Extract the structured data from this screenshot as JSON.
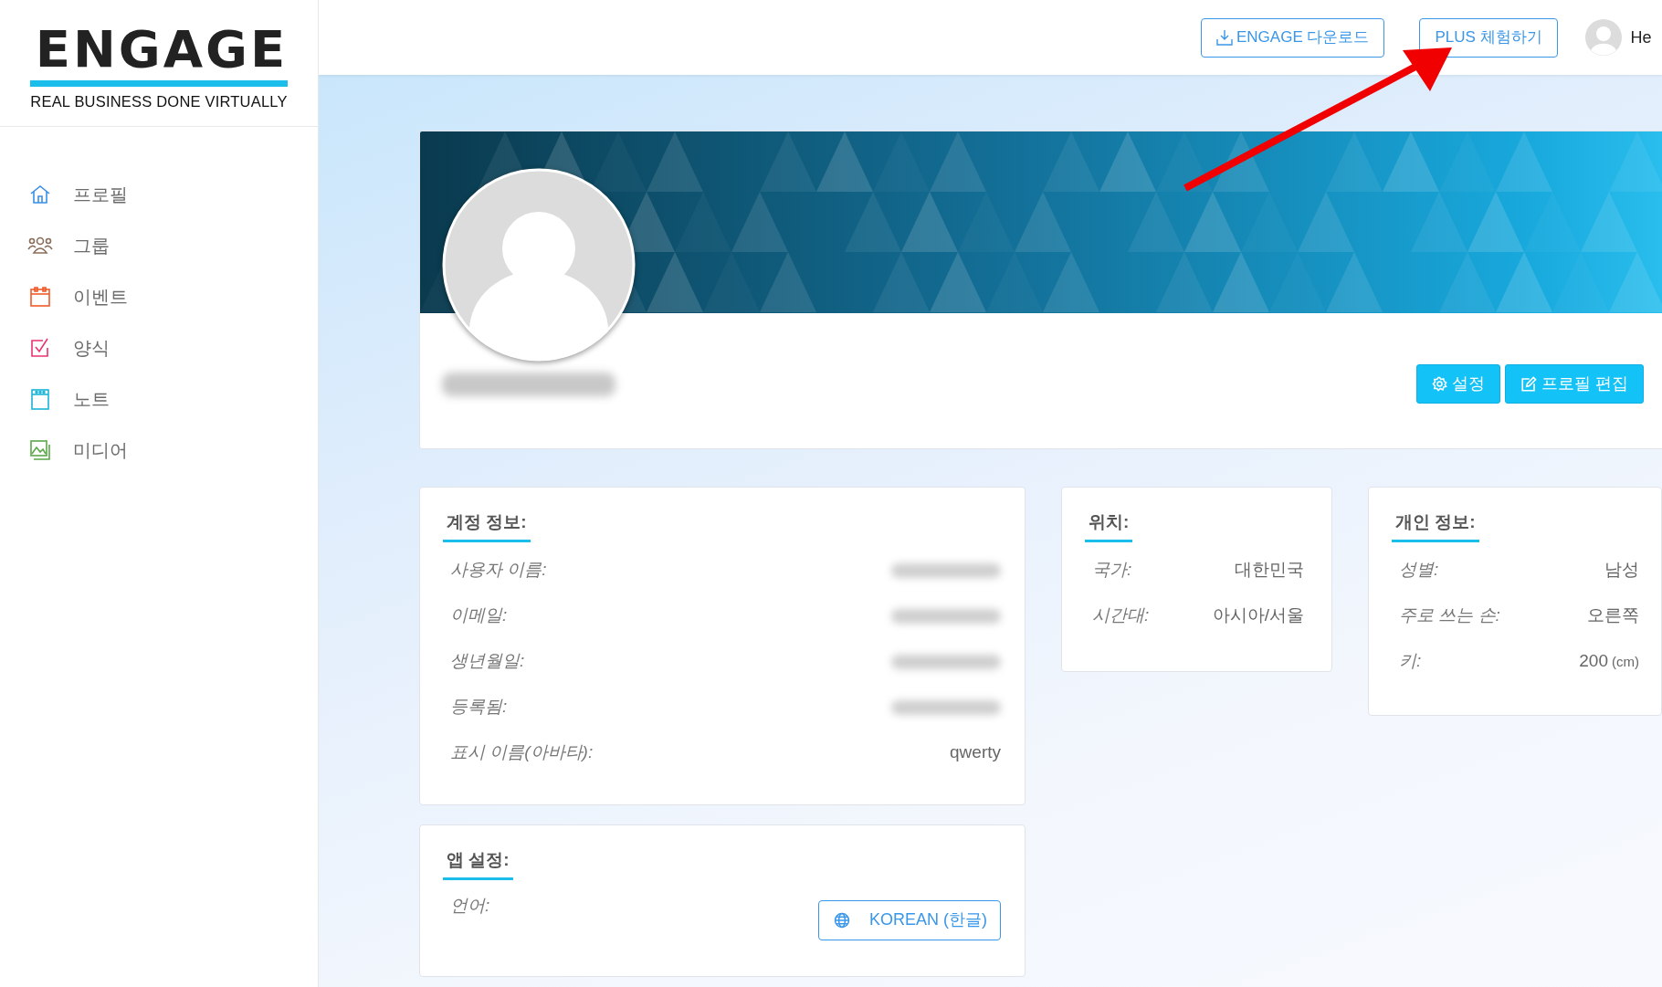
{
  "logo": {
    "wordmark": "ENGAGE",
    "tagline": "REAL BUSINESS DONE VIRTUALLY"
  },
  "sidebar": {
    "items": [
      {
        "kind": "home",
        "label": "프로필"
      },
      {
        "kind": "group",
        "label": "그룹"
      },
      {
        "kind": "calendar",
        "label": "이벤트"
      },
      {
        "kind": "form",
        "label": "양식"
      },
      {
        "kind": "note",
        "label": "노트"
      },
      {
        "kind": "media",
        "label": "미디어"
      }
    ]
  },
  "header": {
    "buttons": [
      {
        "kind": "download",
        "label": "ENGAGE 다운로드"
      },
      {
        "kind": "plain",
        "label": "PLUS 체험하기"
      }
    ],
    "user": {
      "name": "He"
    }
  },
  "profile": {
    "name_redacted": true,
    "buttons": [
      {
        "kind": "settings",
        "label": "설정"
      },
      {
        "kind": "edit",
        "label": "프로필 편집"
      }
    ]
  },
  "account_card": {
    "title": "계정 정보:",
    "rows": [
      {
        "label": "사용자 이름:",
        "redacted": true
      },
      {
        "label": "이메일:",
        "redacted": true
      },
      {
        "label": "생년월일:",
        "redacted": true
      },
      {
        "label": "등록됨:",
        "redacted": true
      },
      {
        "label": "표시 이름(아바타):",
        "value": "qwerty"
      }
    ]
  },
  "app_settings_card": {
    "title": "앱 설정:",
    "rows": [
      {
        "label": "언어:",
        "kind": "select",
        "value": "KOREAN (한글)"
      }
    ]
  },
  "location_card": {
    "title": "위치:",
    "rows": [
      {
        "label": "국가:",
        "value": "대한민국"
      },
      {
        "label": "시간대:",
        "value": "아시아/서울"
      }
    ]
  },
  "personal_card": {
    "title": "개인 정보:",
    "rows": [
      {
        "label": "성별:",
        "value": "남성"
      },
      {
        "label": "주로 쓰는 손:",
        "value": "오른쪽"
      },
      {
        "label": "키:",
        "value": "200",
        "unit": "(cm)"
      }
    ]
  },
  "annotation": {
    "kind": "arrow"
  }
}
